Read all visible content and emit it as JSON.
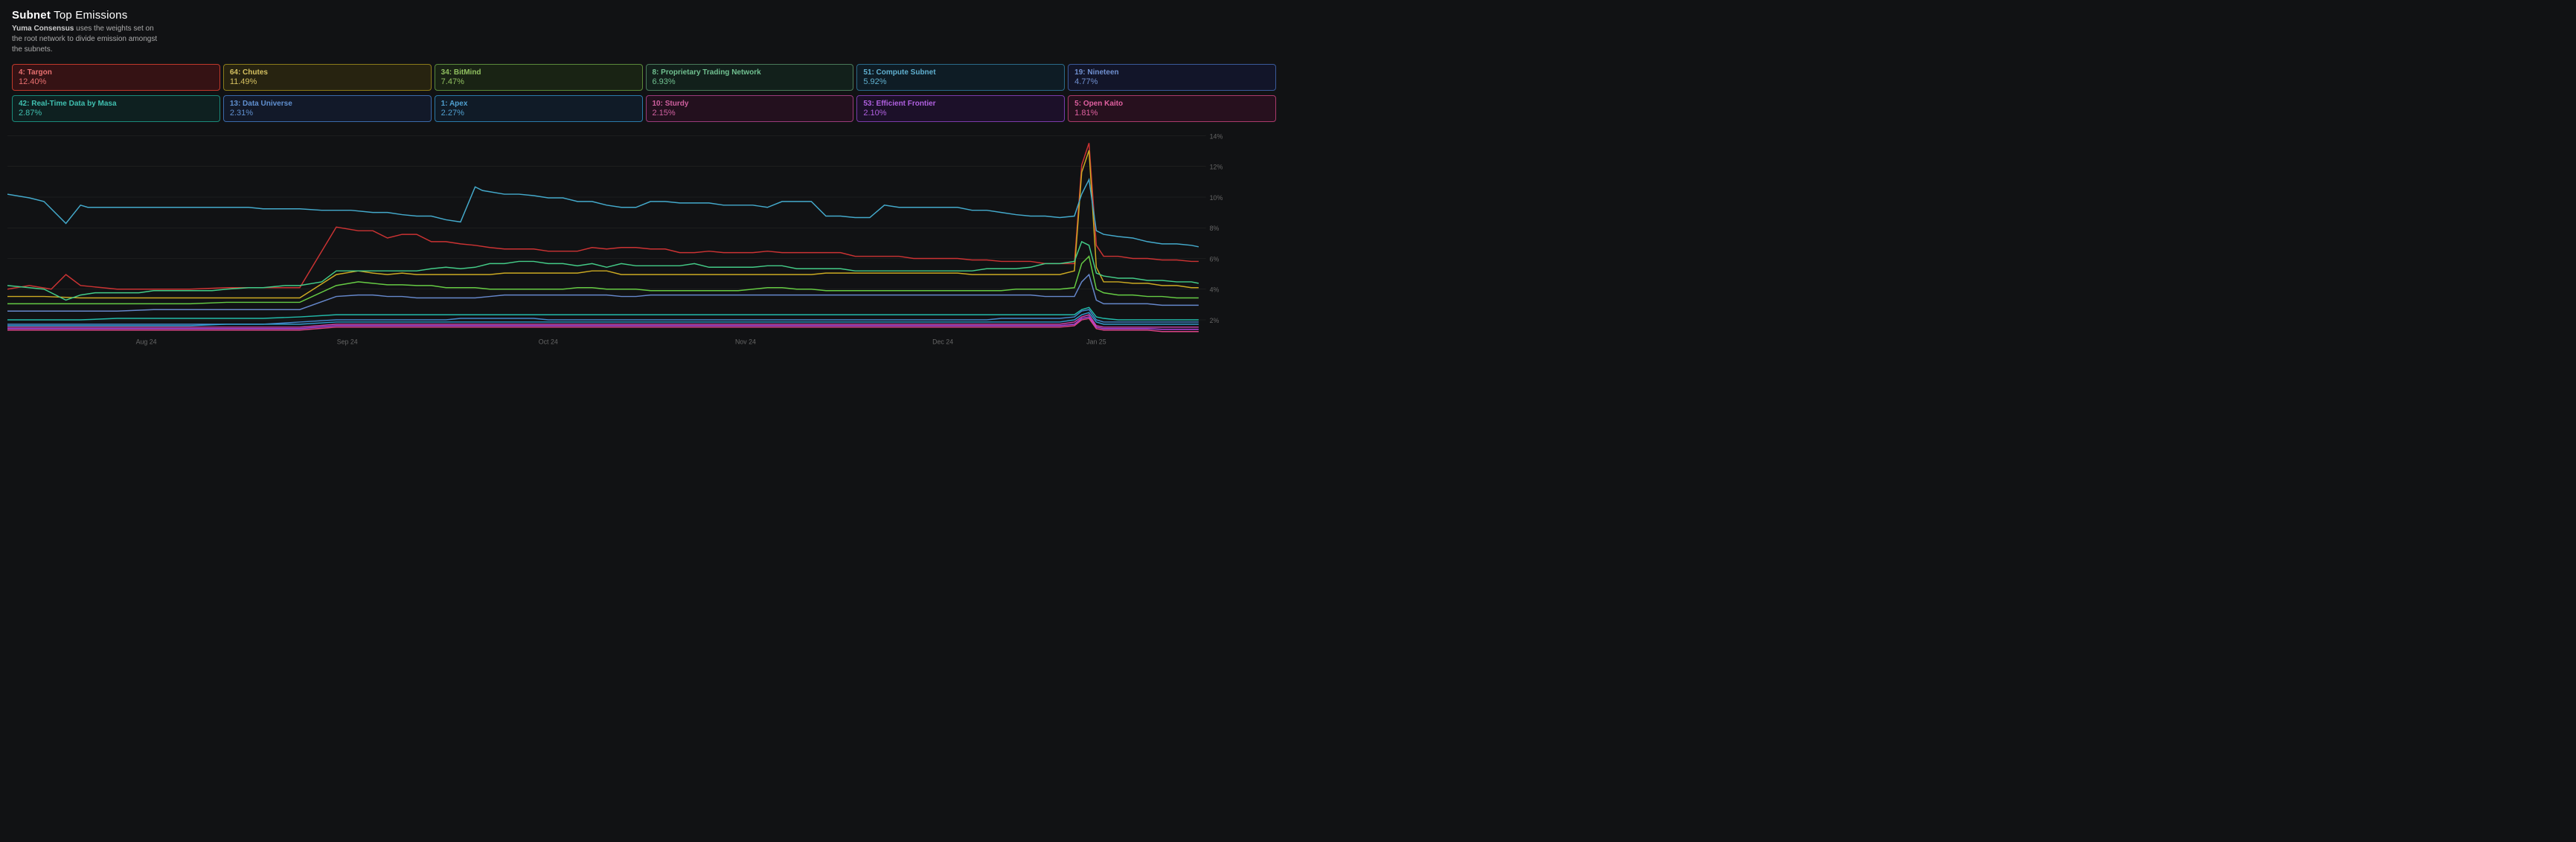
{
  "title": {
    "bold": "Subnet",
    "rest": " Top Emissions"
  },
  "subtitle": {
    "bold_part": "Yuma Consensus",
    "rest": " uses the weights set on the root network to divide emission amongst the subnets."
  },
  "legend_row1": [
    {
      "id": "4",
      "name": "Targon",
      "value": "12.40%",
      "border_color": "#c0392b",
      "bg_color": "rgba(120,20,20,0.35)",
      "text_color": "#e87070"
    },
    {
      "id": "64",
      "name": "Chutes",
      "value": "11.49%",
      "border_color": "#8B7B1A",
      "bg_color": "rgba(80,70,10,0.35)",
      "text_color": "#d4c060"
    },
    {
      "id": "34",
      "name": "BitMind",
      "value": "7.47%",
      "border_color": "#5a8a3a",
      "bg_color": "rgba(40,70,20,0.35)",
      "text_color": "#90c060"
    },
    {
      "id": "8",
      "name": "Proprietary Trading Network",
      "value": "6.93%",
      "border_color": "#4a7a5a",
      "bg_color": "rgba(20,60,40,0.35)",
      "text_color": "#70c090"
    },
    {
      "id": "51",
      "name": "Compute Subnet",
      "value": "5.92%",
      "border_color": "#2a6a8a",
      "bg_color": "rgba(10,50,70,0.35)",
      "text_color": "#60b0d0"
    },
    {
      "id": "19",
      "name": "Nineteen",
      "value": "4.77%",
      "border_color": "#3a5a9a",
      "bg_color": "rgba(20,30,80,0.35)",
      "text_color": "#7090d0"
    }
  ],
  "legend_row2": [
    {
      "id": "42",
      "name": "Real-Time Data by Masa",
      "value": "2.87%",
      "border_color": "#1a8a7a",
      "bg_color": "rgba(10,60,55,0.35)",
      "text_color": "#40c0b0"
    },
    {
      "id": "13",
      "name": "Data Universe",
      "value": "2.31%",
      "border_color": "#3a6aaa",
      "bg_color": "rgba(20,40,80,0.35)",
      "text_color": "#6090d0"
    },
    {
      "id": "1",
      "name": "Apex",
      "value": "2.27%",
      "border_color": "#2a7aaa",
      "bg_color": "rgba(15,45,75,0.35)",
      "text_color": "#50a0d0"
    },
    {
      "id": "10",
      "name": "Sturdy",
      "value": "2.15%",
      "border_color": "#9a3a7a",
      "bg_color": "rgba(70,15,50,0.35)",
      "text_color": "#d060a0"
    },
    {
      "id": "53",
      "name": "Efficient Frontier",
      "value": "2.10%",
      "border_color": "#7a3aaa",
      "bg_color": "rgba(50,15,80,0.35)",
      "text_color": "#b060e0"
    },
    {
      "id": "5",
      "name": "Open Kaito",
      "value": "1.81%",
      "border_color": "#aa3a6a",
      "bg_color": "rgba(80,15,50,0.35)",
      "text_color": "#e060a0"
    }
  ],
  "y_axis": [
    "14%",
    "12%",
    "10%",
    "8%",
    "6%",
    "4%",
    "2%"
  ],
  "x_axis": [
    "Aug 24",
    "Sep 24",
    "Oct 24",
    "Nov 24",
    "Dec 24",
    "Jan 25"
  ],
  "chart": {
    "colors": {
      "targon": "#cc3333",
      "chutes": "#ccaa22",
      "bitmind": "#66cc44",
      "prop_trading": "#44cc88",
      "compute": "#44aacc",
      "nineteen": "#6688cc",
      "masa": "#22bbaa",
      "data_universe": "#4488cc",
      "apex": "#3399cc",
      "sturdy": "#cc44aa",
      "efficient": "#aa44dd",
      "open_kaito": "#dd4488"
    }
  }
}
